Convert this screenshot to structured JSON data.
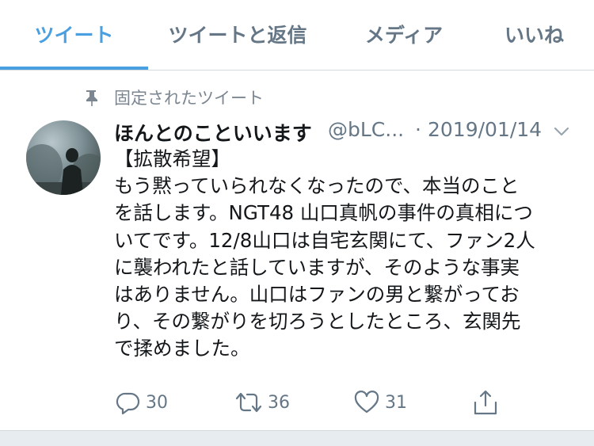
{
  "tabs": [
    {
      "label": "ツイート",
      "active": true
    },
    {
      "label": "ツイートと返信",
      "active": false
    },
    {
      "label": "メディア",
      "active": false
    },
    {
      "label": "いいね",
      "active": false
    }
  ],
  "pinned": {
    "label": "固定されたツイート",
    "icon": "pin-icon"
  },
  "tweet": {
    "display_name": "ほんとのこといいます",
    "handle": "@bLC...",
    "separator": "·",
    "date": "2019/01/14",
    "menu_icon": "chevron-down-icon",
    "lines": [
      "【拡散希望】",
      "もう黙っていられなくなったので、本当のこと",
      "を話します。NGT48 山口真帆の事件の真相につ",
      "いてです。12/8山口は自宅玄関にて、ファン2人",
      "に襲われたと話していますが、そのような事実",
      "はありません。山口はファンの男と繋がってお",
      "り、その繋がりを切ろうとしたところ、玄関先",
      "で揉めました。"
    ],
    "actions": {
      "reply_count": "30",
      "retweet_count": "36",
      "like_count": "31"
    }
  },
  "colors": {
    "accent": "#4a9fe0",
    "text": "#14171a",
    "secondary": "#657786",
    "divider": "#d4d9de"
  }
}
